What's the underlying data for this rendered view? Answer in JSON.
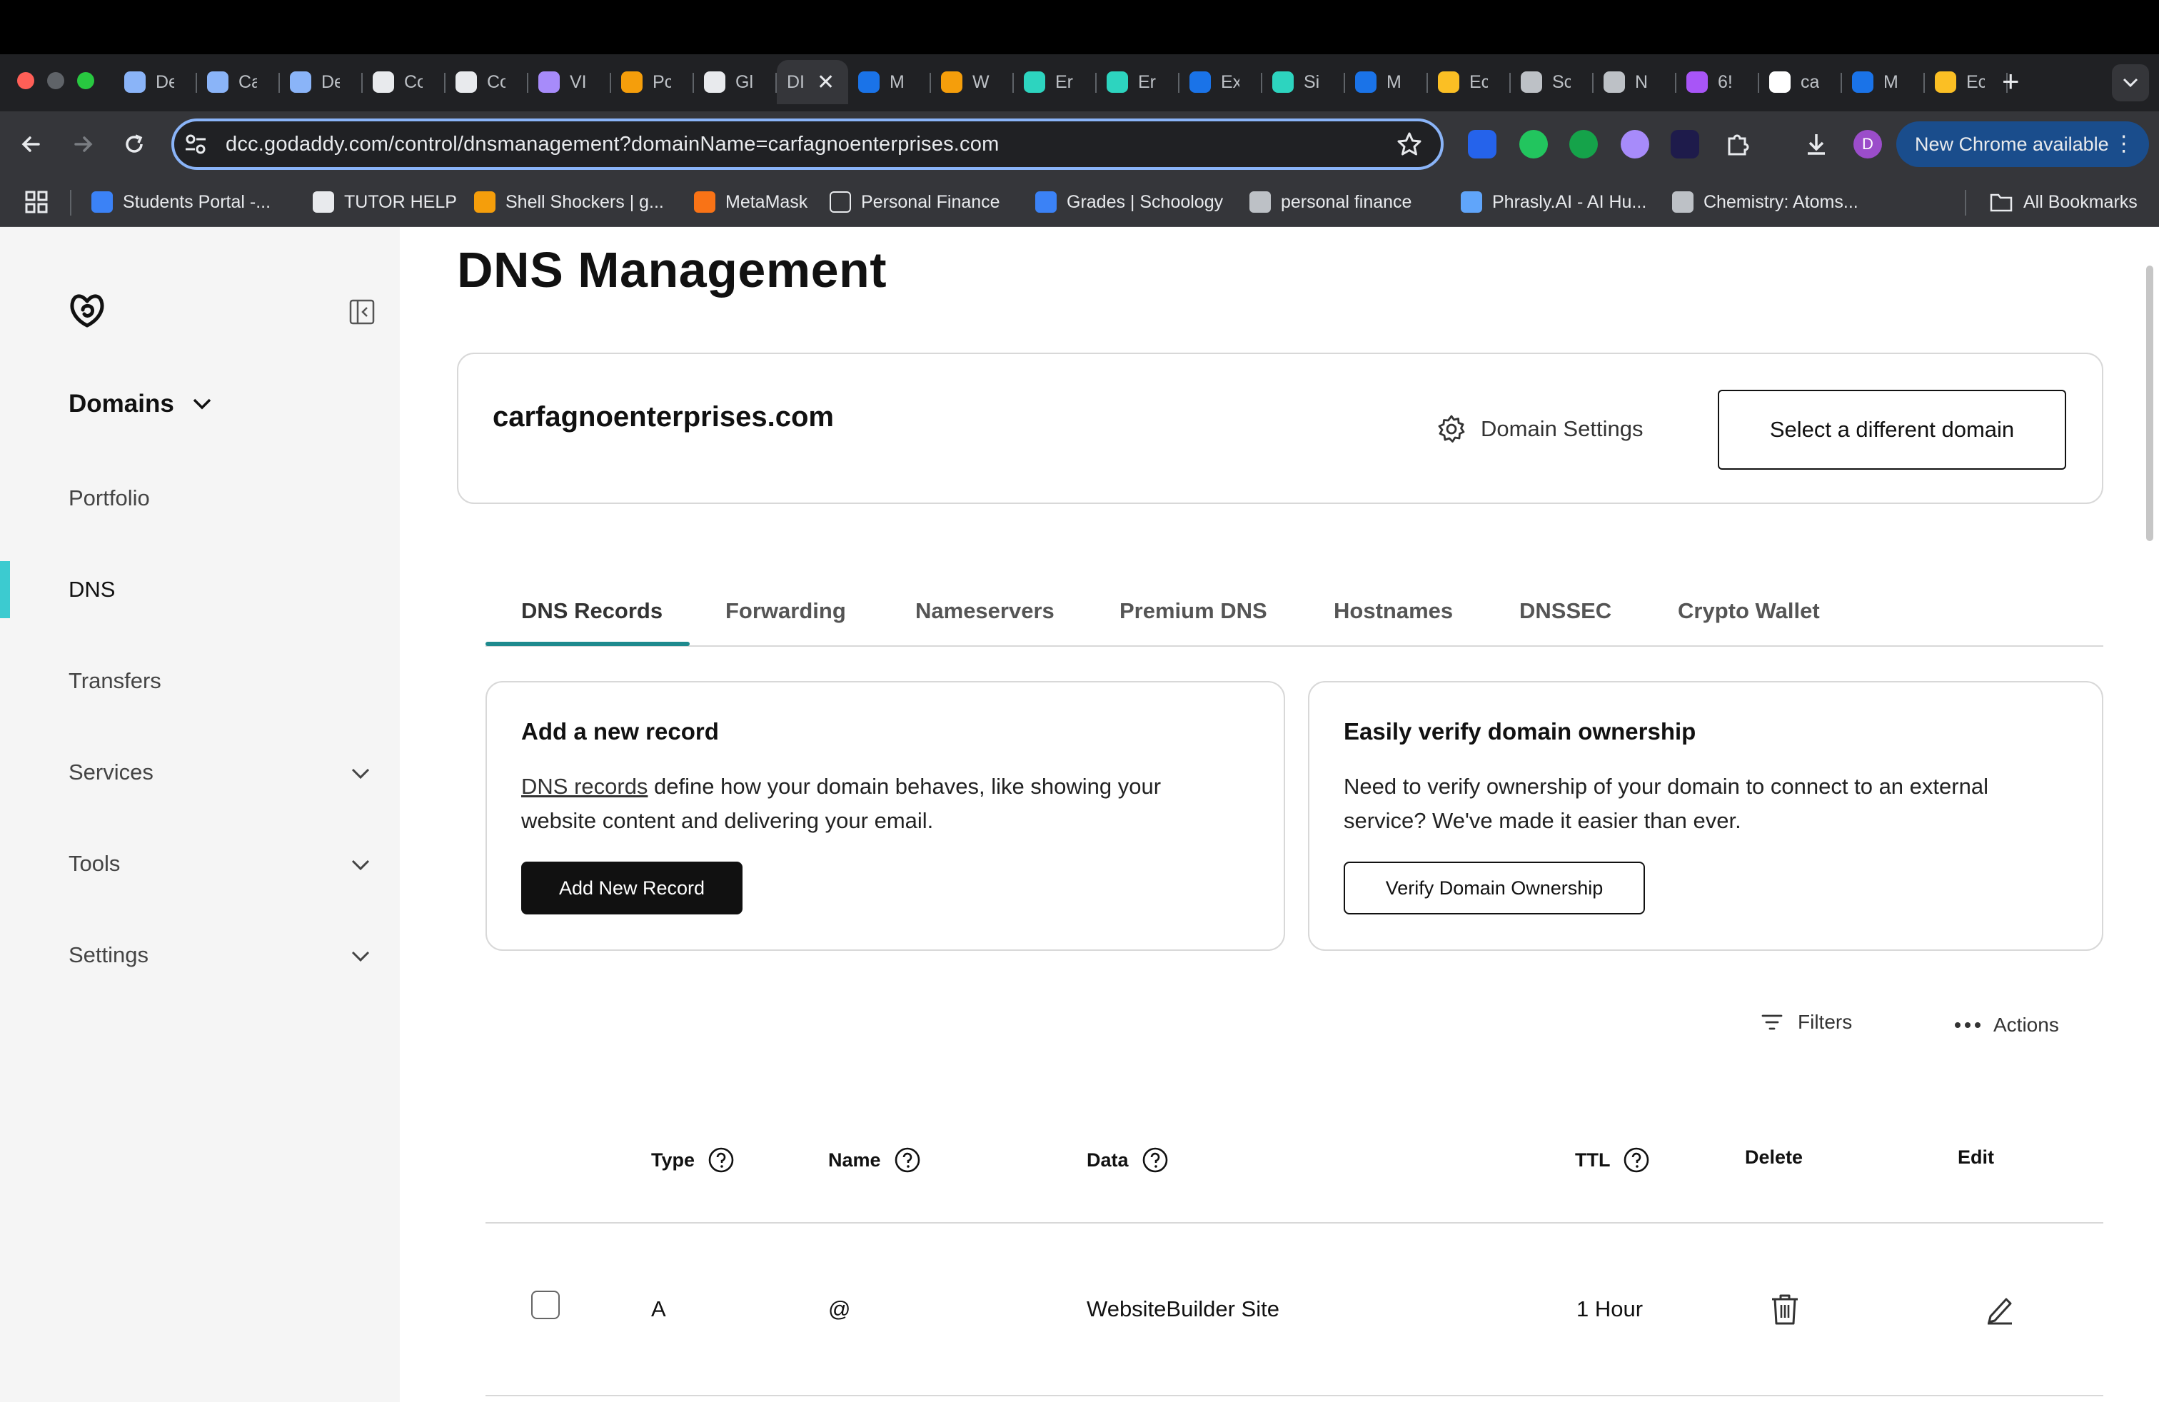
{
  "browser": {
    "tabs": [
      {
        "label": "De",
        "color": "#8ab4f8"
      },
      {
        "label": "Ca",
        "color": "#8ab4f8"
      },
      {
        "label": "De",
        "color": "#8ab4f8"
      },
      {
        "label": "Co",
        "color": "#e8eaed"
      },
      {
        "label": "Co",
        "color": "#e8eaed"
      },
      {
        "label": "VI",
        "color": "#a78bfa"
      },
      {
        "label": "Pc",
        "color": "#f59e0b"
      },
      {
        "label": "Gl",
        "color": "#e8eaed"
      },
      {
        "label": "DI",
        "color": "#35363a",
        "active": true
      },
      {
        "label": "M",
        "color": "#1a73e8"
      },
      {
        "label": "W",
        "color": "#f59e0b"
      },
      {
        "label": "Er",
        "color": "#2dd4bf"
      },
      {
        "label": "Er",
        "color": "#2dd4bf"
      },
      {
        "label": "Ex",
        "color": "#1a73e8"
      },
      {
        "label": "Si",
        "color": "#2dd4bf"
      },
      {
        "label": "M",
        "color": "#1a73e8"
      },
      {
        "label": "Ec",
        "color": "#fbbf24"
      },
      {
        "label": "Sc",
        "color": "#bdc1c6"
      },
      {
        "label": "N",
        "color": "#bdc1c6"
      },
      {
        "label": "6!",
        "color": "#a855f7"
      },
      {
        "label": "ca",
        "color": "#ffffff"
      },
      {
        "label": "M",
        "color": "#1a73e8"
      },
      {
        "label": "Ec",
        "color": "#fbbf24"
      }
    ],
    "url": "dcc.godaddy.com/control/dnsmanagement?domainName=carfagnoenterprises.com",
    "update_label": "New Chrome available",
    "profile_initial": "D",
    "bookmarks": [
      {
        "label": "Students Portal -...",
        "color": "#3b82f6"
      },
      {
        "label": "TUTOR HELP",
        "color": "#e8eaed"
      },
      {
        "label": "Shell Shockers | g...",
        "color": "#f59e0b"
      },
      {
        "label": "MetaMask",
        "color": "#f97316"
      },
      {
        "label": "Personal Finance",
        "color": "#35363a"
      },
      {
        "label": "Grades | Schoology",
        "color": "#3b82f6"
      },
      {
        "label": "personal finance",
        "color": "#bdc1c6"
      },
      {
        "label": "Phrasly.AI - AI Hu...",
        "color": "#60a5fa"
      },
      {
        "label": "Chemistry: Atoms...",
        "color": "#bdc1c6"
      }
    ],
    "all_bookmarks_label": "All Bookmarks"
  },
  "sidebar": {
    "section_label": "Domains",
    "items": [
      {
        "label": "Portfolio"
      },
      {
        "label": "DNS",
        "active": true
      },
      {
        "label": "Transfers"
      },
      {
        "label": "Services",
        "expandable": true
      },
      {
        "label": "Tools",
        "expandable": true
      },
      {
        "label": "Settings",
        "expandable": true
      }
    ]
  },
  "page": {
    "title": "DNS Management",
    "domain": "carfagnoenterprises.com",
    "domain_settings_label": "Domain Settings",
    "select_domain_label": "Select a different domain",
    "tabs": [
      "DNS Records",
      "Forwarding",
      "Nameservers",
      "Premium DNS",
      "Hostnames",
      "DNSSEC",
      "Crypto Wallet"
    ],
    "active_tab": "DNS Records"
  },
  "cards": {
    "add_record": {
      "title": "Add a new record",
      "link_text": "DNS records",
      "text_line1_rest": " define how your domain behaves, like showing your",
      "text_line2": "website content and delivering your email.",
      "button": "Add New Record"
    },
    "verify": {
      "title": "Easily verify domain ownership",
      "text_line1": "Need to verify ownership of your domain to connect to an external",
      "text_line2": "service? We've made it easier than ever.",
      "button": "Verify Domain Ownership"
    }
  },
  "table": {
    "filters_label": "Filters",
    "actions_label": "Actions",
    "columns": {
      "type": "Type",
      "name": "Name",
      "data": "Data",
      "ttl": "TTL",
      "delete": "Delete",
      "edit": "Edit"
    },
    "rows": [
      {
        "type": "A",
        "name": "@",
        "data": "WebsiteBuilder Site",
        "ttl": "1 Hour"
      }
    ]
  }
}
